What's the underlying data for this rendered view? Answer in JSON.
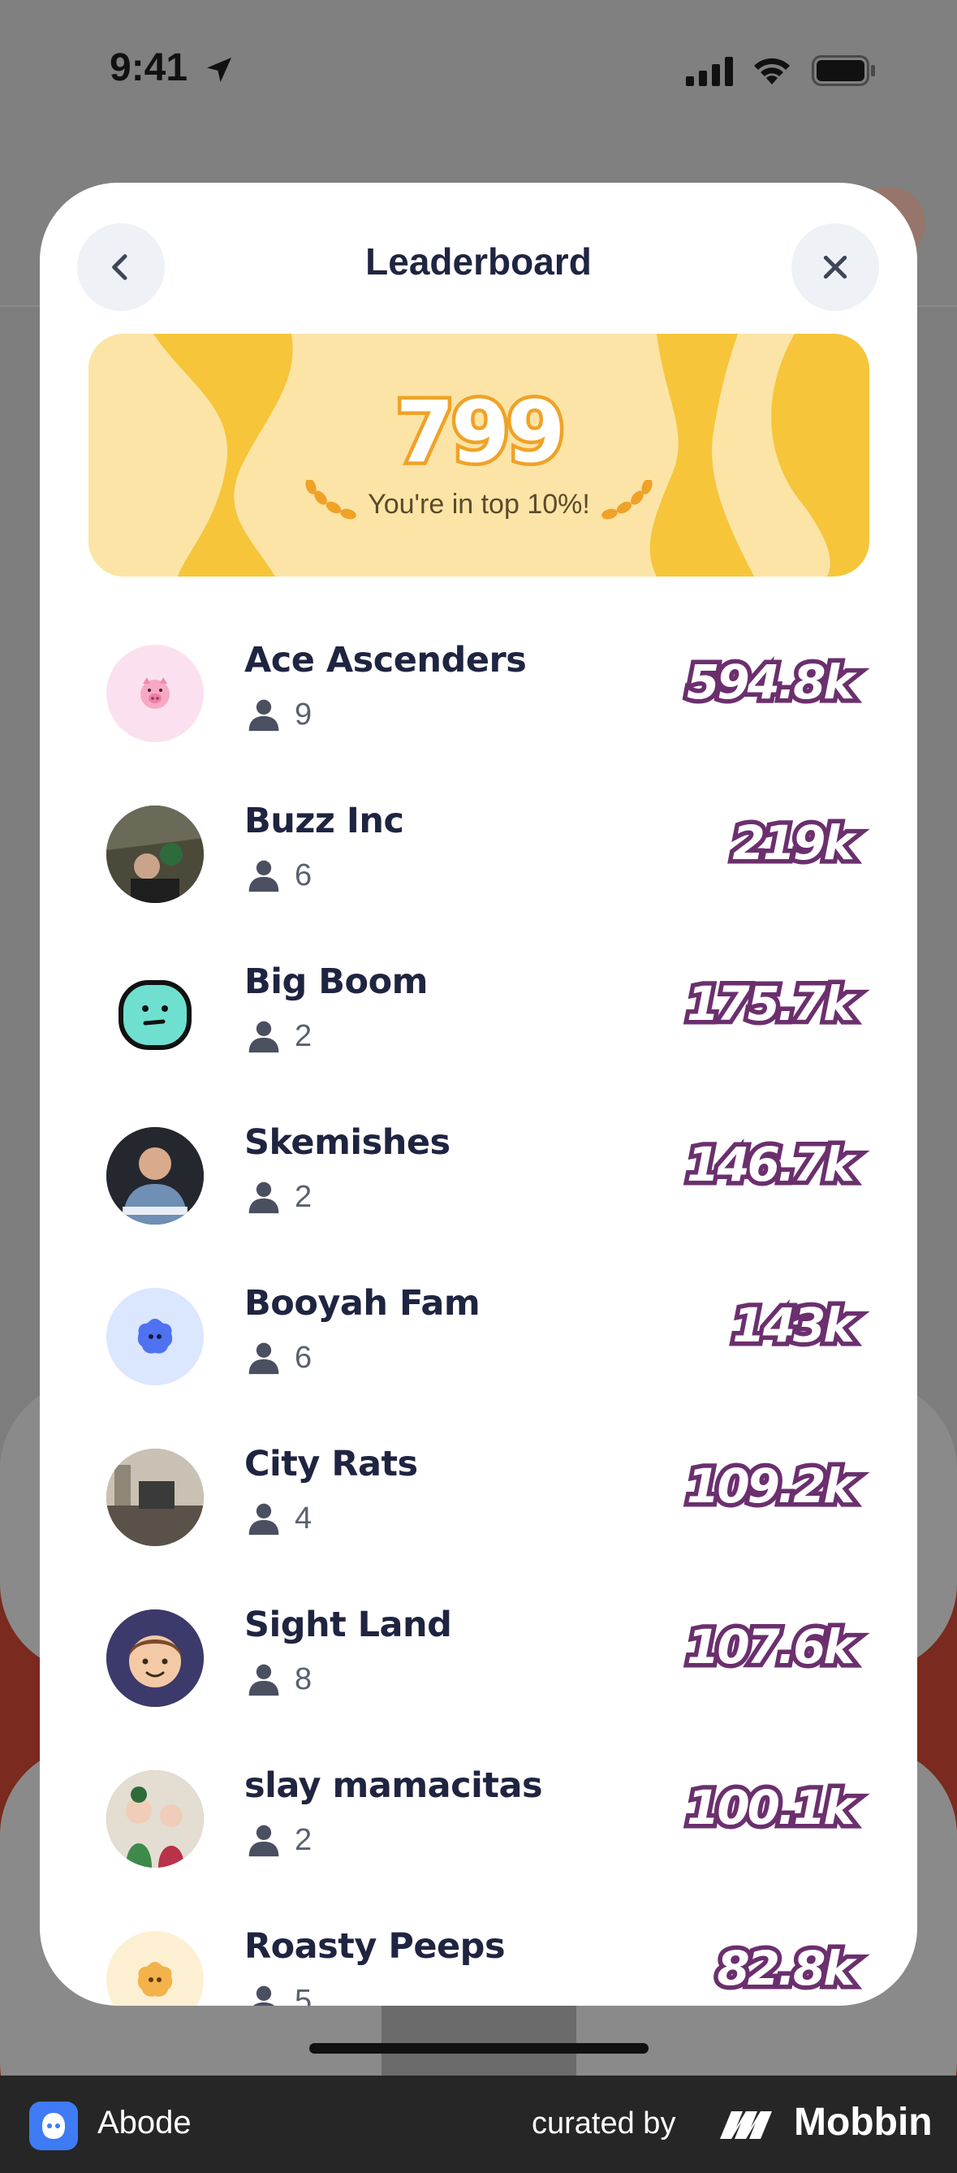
{
  "status_bar": {
    "time": "9:41",
    "icons": [
      "location-arrow-icon",
      "cellular-signal-icon",
      "wifi-icon",
      "battery-icon"
    ]
  },
  "modal": {
    "title": "Leaderboard",
    "back_icon": "chevron-left-icon",
    "close_icon": "close-icon"
  },
  "banner": {
    "score": "799",
    "rank_text": "You're in top 10%!",
    "colors": {
      "primary": "#f6c53a",
      "light": "#fbe4a6",
      "score_stroke": "#f0a227"
    }
  },
  "leaderboard": [
    {
      "name": "Ace Ascenders",
      "members": "9",
      "points": "594.8k",
      "avatar": "pig-emoji",
      "avatar_bg": "#fbe1ef"
    },
    {
      "name": "Buzz Inc",
      "members": "6",
      "points": "219k",
      "avatar": "photo",
      "avatar_bg": "#3a3a2e"
    },
    {
      "name": "Big Boom",
      "members": "2",
      "points": "175.7k",
      "avatar": "teal-face",
      "avatar_bg": "#ffffff"
    },
    {
      "name": "Skemishes",
      "members": "2",
      "points": "146.7k",
      "avatar": "photo",
      "avatar_bg": "#2f3a4a"
    },
    {
      "name": "Booyah Fam",
      "members": "6",
      "points": "143k",
      "avatar": "blue-blob",
      "avatar_bg": "#dbe6ff"
    },
    {
      "name": "City Rats",
      "members": "4",
      "points": "109.2k",
      "avatar": "photo",
      "avatar_bg": "#8a8272"
    },
    {
      "name": "Sight Land",
      "members": "8",
      "points": "107.6k",
      "avatar": "boy-emoji",
      "avatar_bg": "#3c3a6a"
    },
    {
      "name": "slay mamacitas",
      "members": "2",
      "points": "100.1k",
      "avatar": "photo",
      "avatar_bg": "#7a6a5a"
    },
    {
      "name": "Roasty Peeps",
      "members": "5",
      "points": "82.8k",
      "avatar": "orange-blob",
      "avatar_bg": "#fdf0d2"
    }
  ],
  "points_stroke_color": "#6b2f6e",
  "footer": {
    "app_name": "Abode",
    "curated_by": "curated by",
    "brand": "Mobbin"
  }
}
